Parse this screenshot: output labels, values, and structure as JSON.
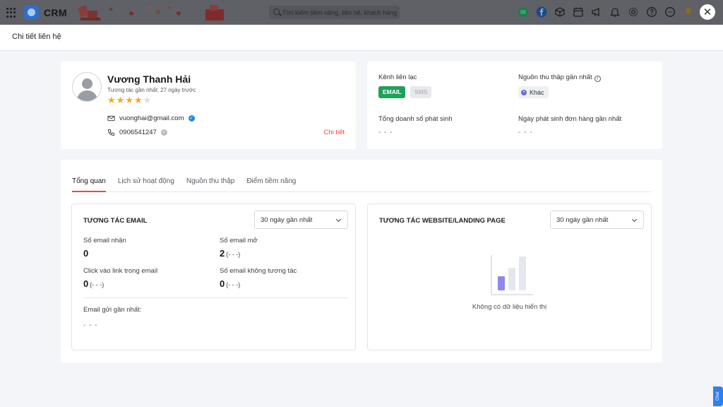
{
  "app": {
    "name": "CRM"
  },
  "search": {
    "placeholder": "Tìm kiếm tiềm năng, liên hệ, khách hàng"
  },
  "top_icons": [
    "app-badge-icon",
    "facebook-icon",
    "cube-icon",
    "calendar-icon",
    "megaphone-icon",
    "bell-icon",
    "settings-icon",
    "help-icon",
    "more-icon",
    "lightbulb-icon"
  ],
  "page": {
    "title": "Chi tiết liên hệ"
  },
  "profile": {
    "name": "Vương Thanh Hải",
    "last_interaction": "Tương tác gần nhất: 27 ngày trước",
    "rating": 4,
    "rating_max": 5,
    "email": "vuonghai@gmail.com",
    "phone": "0906541247",
    "detail_link": "Chi tiết"
  },
  "info": {
    "channels_label": "Kênh liên lạc",
    "channel_email": "EMAIL",
    "channel_sms": "SMS",
    "source_label": "Nguồn thu thập gần nhất",
    "source_value": "Khác",
    "revenue_label": "Tổng doanh số phát sinh",
    "revenue_value": "- - -",
    "last_order_label": "Ngày phát sinh đơn hàng gần nhất",
    "last_order_value": "- - -"
  },
  "tabs": [
    "Tổng quan",
    "Lịch sử hoạt động",
    "Nguồn thu thập",
    "Điểm tiềm năng"
  ],
  "email_panel": {
    "title": "TƯƠNG TÁC EMAIL",
    "range": "30 ngày gần nhất",
    "received_label": "Số email nhận",
    "received_value": "0",
    "opened_label": "Số email mở",
    "opened_value": "2",
    "opened_delta": "(- - -)",
    "clicks_label": "Click vào link trong email",
    "clicks_value": "0",
    "clicks_delta": "(- - -)",
    "no_interaction_label": "Số email không tương tác",
    "no_interaction_value": "0",
    "no_interaction_delta": "(- - -)",
    "last_sent_label": "Email gửi gần nhất:",
    "last_sent_value": "- - -"
  },
  "web_panel": {
    "title": "TƯƠNG TÁC WEBSITE/LANDING PAGE",
    "range": "30 ngày gần nhất",
    "empty_text": "Không có dữ liệu hiển thị"
  },
  "chat": {
    "label": "Chat"
  },
  "colors": {
    "accent": "#e8493b",
    "email_badge": "#1ea15a",
    "star": "#f5a623",
    "overlay": "#5f6166"
  }
}
